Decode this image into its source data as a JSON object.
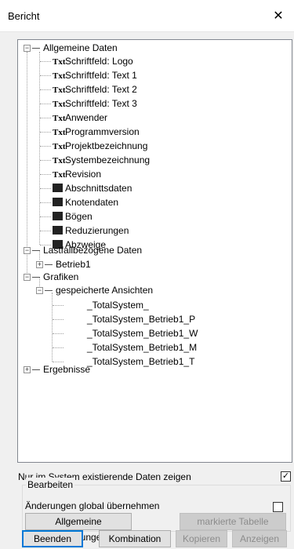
{
  "window": {
    "title": "Bericht",
    "close_icon": "close-icon"
  },
  "tree": {
    "allgemeine": "Allgemeine Daten",
    "txt_badge": "Txt",
    "items": [
      "Schriftfeld: Logo",
      "Schriftfeld: Text 1",
      "Schriftfeld: Text 2",
      "Schriftfeld: Text 3",
      "Anwender",
      "Programmversion",
      "Projektbezeichnung",
      "Systembezeichnung",
      "Revision",
      "Abschnittsdaten",
      "Knotendaten",
      "Bögen",
      "Reduzierungen",
      "Abzweige"
    ],
    "lastfall": "Lastfallbezogene Daten",
    "betrieb1": "Betrieb1",
    "grafiken": "Grafiken",
    "gespeichert": "gespeicherte Ansichten",
    "ansichten": [
      "_TotalSystem_",
      "_TotalSystem_Betrieb1_P",
      "_TotalSystem_Betrieb1_W",
      "_TotalSystem_Betrieb1_M",
      "_TotalSystem_Betrieb1_T"
    ],
    "ergebnisse": "Ergebnisse"
  },
  "options": {
    "only_existing": "Nur im System existierende Daten zeigen",
    "only_existing_checked": true
  },
  "bearbeiten": {
    "legend": "Bearbeiten",
    "global_label": "Änderungen global übernehmen",
    "global_checked": false,
    "general_button": "Allgemeine Einstellungen",
    "marked_table_button": "markierte Tabelle"
  },
  "footer": {
    "beenden": "Beenden",
    "kombination": "Kombination",
    "kopieren": "Kopieren",
    "anzeigen": "Anzeigen"
  }
}
